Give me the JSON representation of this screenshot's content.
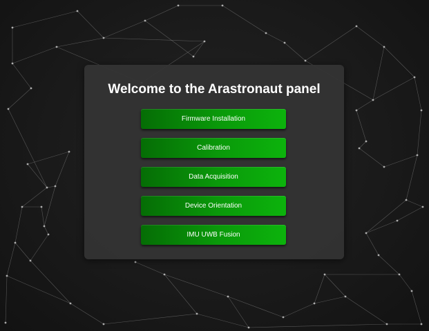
{
  "panel": {
    "title": "Welcome to the Arastronaut panel",
    "buttons": [
      {
        "label": "Firmware Installation"
      },
      {
        "label": "Calibration"
      },
      {
        "label": "Data Acquisition"
      },
      {
        "label": "Device Orientation"
      },
      {
        "label": "IMU UWB Fusion"
      }
    ]
  },
  "colors": {
    "background": "#161616",
    "panel": "#343434",
    "button_dark": "#056d05",
    "button_light": "#0cb30c",
    "network_line": "#8a8a8a",
    "network_node": "#d0d0d0"
  }
}
